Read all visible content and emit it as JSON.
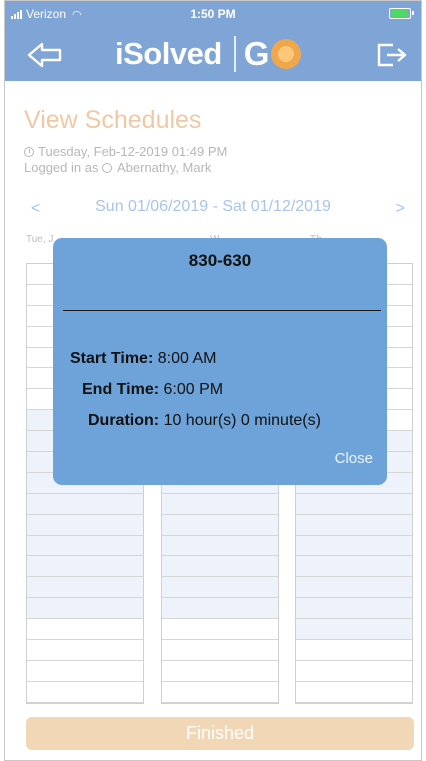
{
  "status_bar": {
    "carrier": "Verizon",
    "time": "1:50 PM"
  },
  "header": {
    "logo_text": "iSolved",
    "logo_go": "G"
  },
  "page": {
    "title": "View Schedules",
    "datetime": "Tuesday, Feb-12-2019 01:49 PM",
    "logged_in_prefix": "Logged in as",
    "user": "Abernathy, Mark"
  },
  "week": {
    "prev": "<",
    "next": ">",
    "range": "Sun 01/06/2019 - Sat 01/12/2019"
  },
  "days": [
    "Tue, J",
    "W",
    "Th"
  ],
  "popup": {
    "title": "830-630",
    "start_label": "Start Time:",
    "start_value": "8:00 AM",
    "end_label": "End Time:",
    "end_value": "6:00 PM",
    "duration_label": "Duration:",
    "duration_value": "10 hour(s) 0 minute(s)",
    "close_label": "Close"
  },
  "footer": {
    "finished_label": "Finished"
  },
  "colors": {
    "header": "#7fa4d6",
    "accent": "#f0a64a",
    "popup": "#6ea3d9"
  }
}
